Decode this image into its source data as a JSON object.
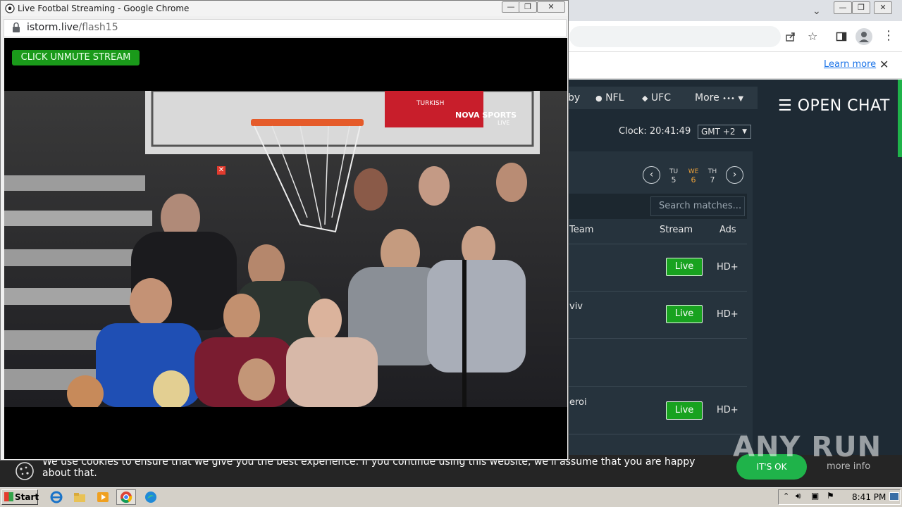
{
  "bg_browser": {
    "infobar_link": "Learn more",
    "infobar_close": "✕"
  },
  "site": {
    "nav": [
      "NFL",
      "UFC",
      "More"
    ],
    "nav_partial": "by",
    "more_dots": "•••",
    "open_chat": "OPEN CHAT",
    "clock": "Clock: 20:41:49",
    "timezone": "GMT +2",
    "days": [
      {
        "dow": "TU",
        "num": "5"
      },
      {
        "dow": "WE",
        "num": "6"
      },
      {
        "dow": "TH",
        "num": "7"
      }
    ],
    "search_placeholder": "Search matches...",
    "headers": {
      "team": "Team",
      "stream": "Stream",
      "ads": "Ads"
    },
    "rows": [
      {
        "team": "",
        "stream": "Live",
        "ads": "HD+"
      },
      {
        "team": "viv",
        "stream": "Live",
        "ads": "HD+"
      },
      {
        "team": "",
        "stream": "",
        "ads": ""
      },
      {
        "team": "eroi",
        "stream": "Live",
        "ads": "HD+"
      }
    ]
  },
  "cookie": {
    "text": "We use cookies to ensure that we give you the best experience. If you continue using this website, we'll assume that you are happy about that.",
    "ok": "IT'S OK",
    "more": "more info"
  },
  "watermark": "ANY RUN",
  "popup": {
    "title": "Live Footbal Streaming - Google Chrome",
    "url_host": "istorm.live",
    "url_path": "/flash15",
    "unmute": "CLICK UNMUTE STREAM",
    "ad_close": "✕",
    "video_logo": "NOVA SPORTS",
    "video_logo_sub": "LIVE",
    "banner_brand": "TURKISH"
  },
  "taskbar": {
    "start": "Start",
    "time": "8:41 PM"
  },
  "colors": {
    "live_green": "#18a21f",
    "accent_green": "#1fb34a",
    "selected_day": "#f0a339",
    "page_bg": "#1e2a34"
  }
}
